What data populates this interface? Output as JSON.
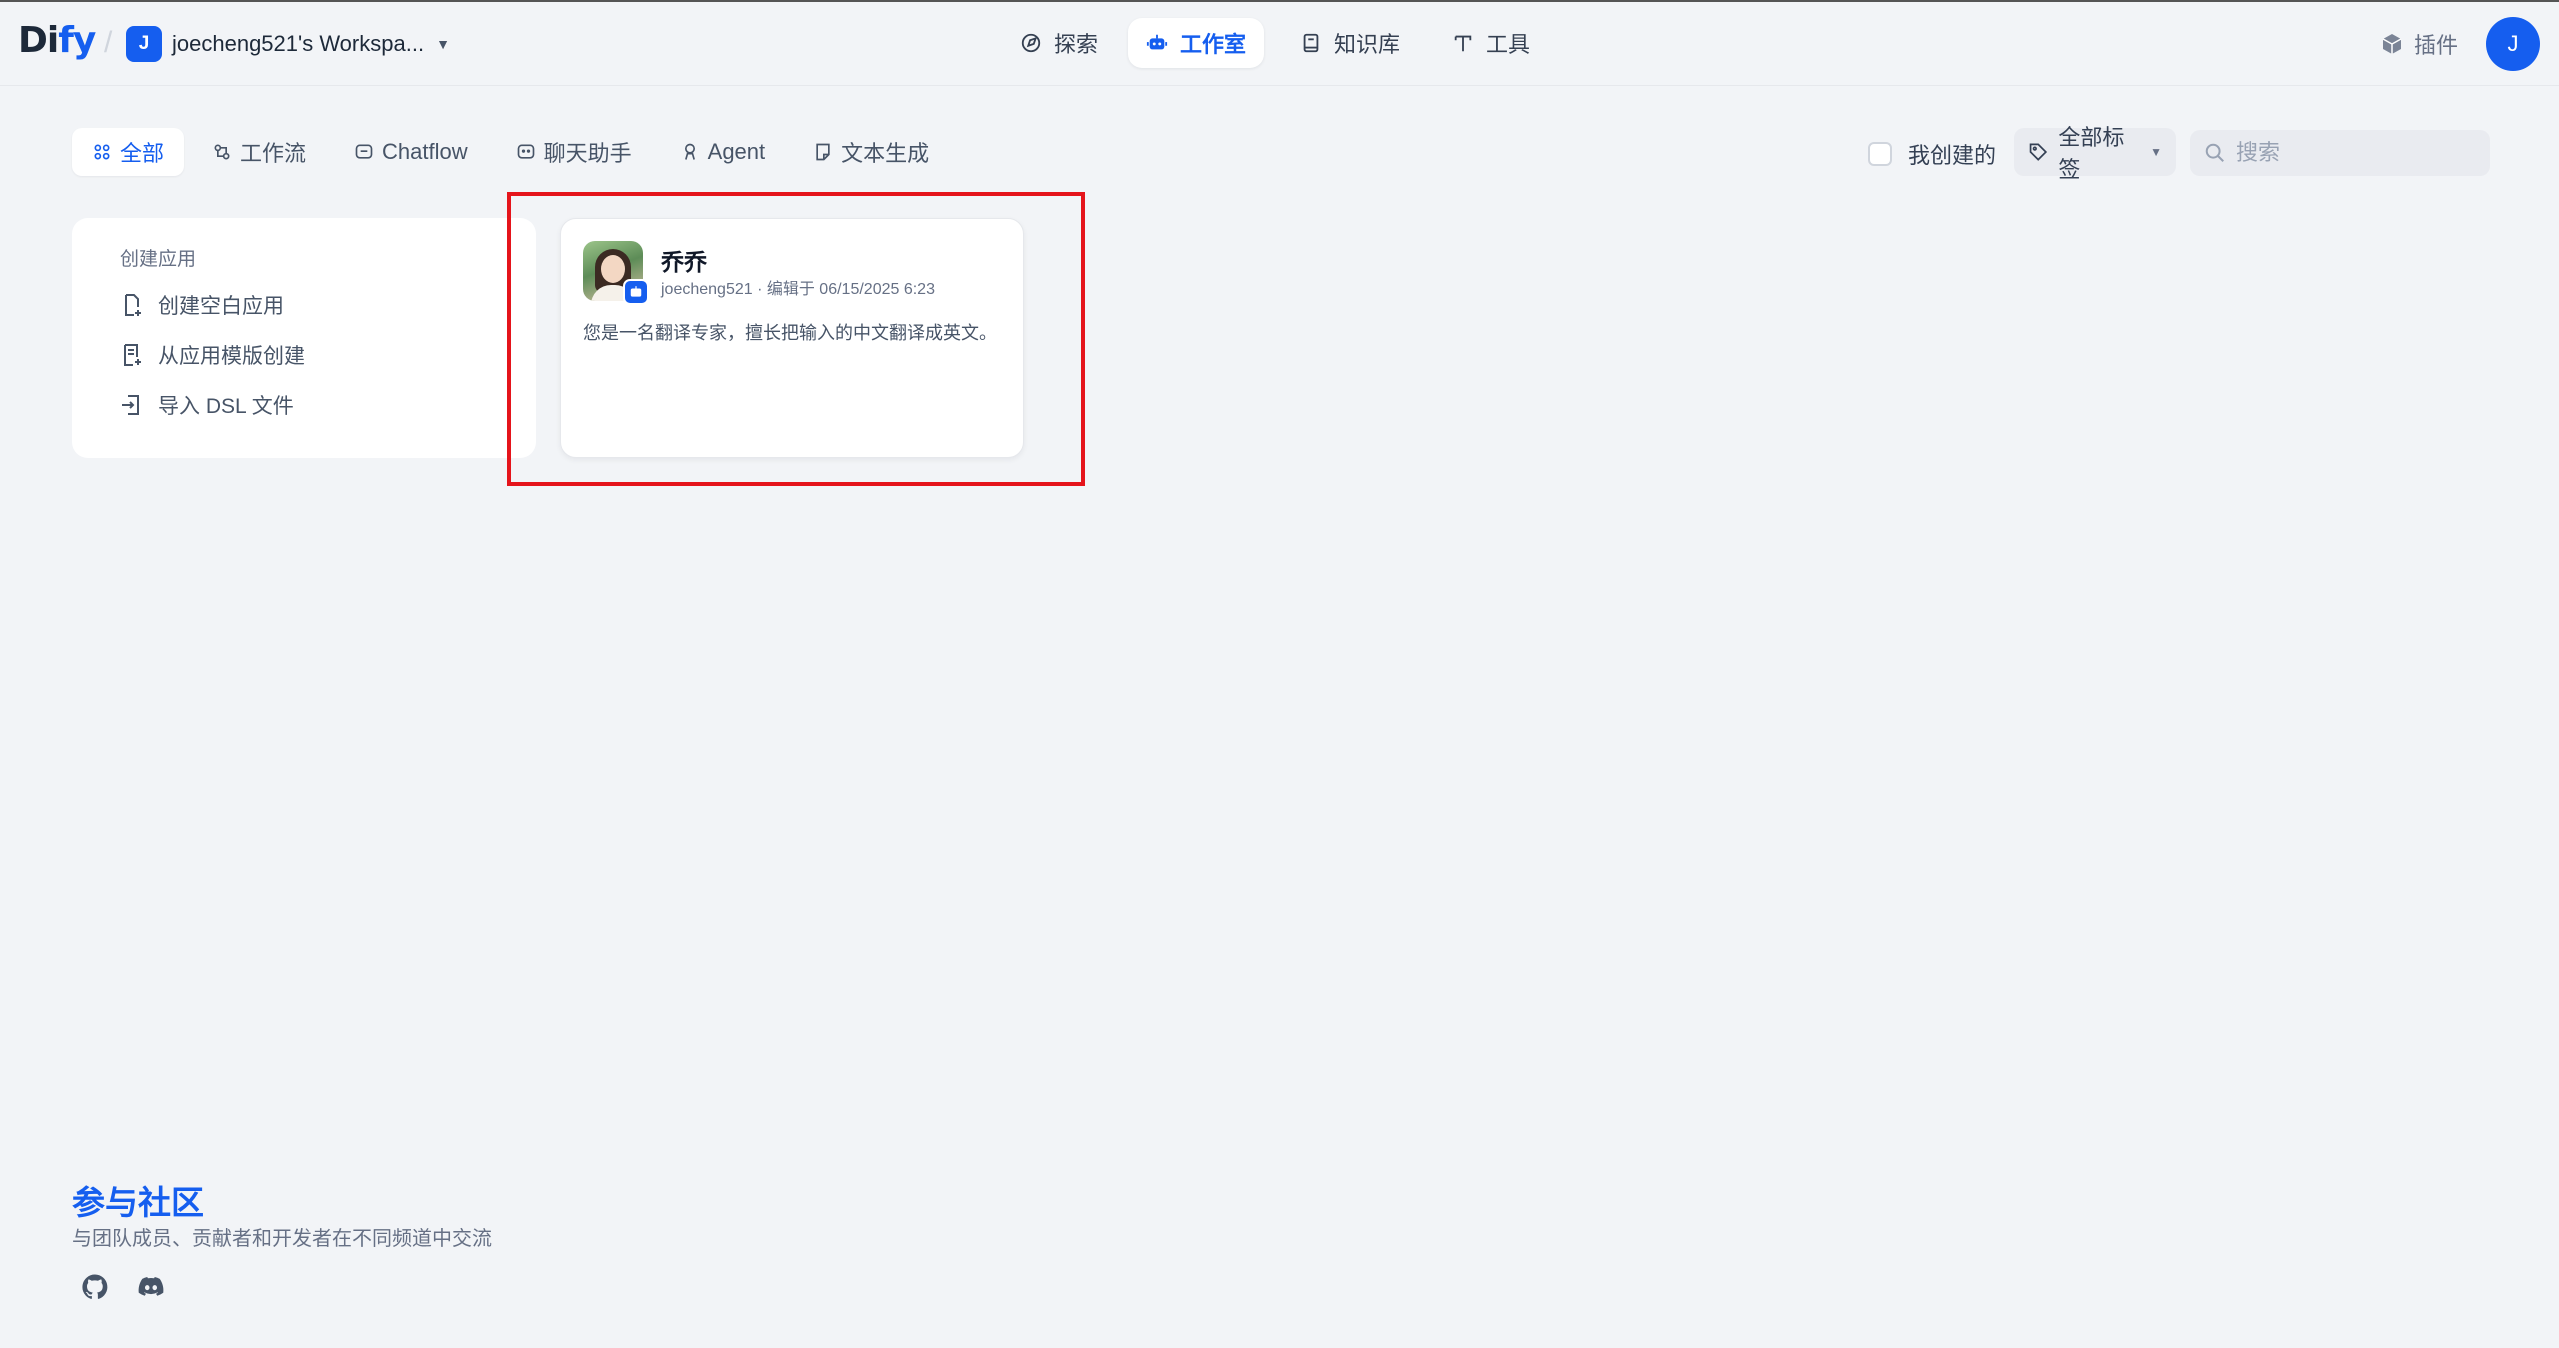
{
  "header": {
    "logo_left": "Di",
    "logo_right": "fy",
    "workspace_initial": "J",
    "workspace_name": "joecheng521's Workspa...",
    "nav": [
      {
        "label": "探索",
        "icon": "compass-icon"
      },
      {
        "label": "工作室",
        "icon": "robot-icon"
      },
      {
        "label": "知识库",
        "icon": "book-icon"
      },
      {
        "label": "工具",
        "icon": "hammer-icon"
      }
    ],
    "plugins_label": "插件",
    "user_initial": "J"
  },
  "filters": {
    "tabs": [
      {
        "label": "全部",
        "icon": "grid-icon",
        "active": true
      },
      {
        "label": "工作流",
        "icon": "workflow-icon"
      },
      {
        "label": "Chatflow",
        "icon": "chatflow-icon"
      },
      {
        "label": "聊天助手",
        "icon": "chat-icon"
      },
      {
        "label": "Agent",
        "icon": "agent-icon"
      },
      {
        "label": "文本生成",
        "icon": "text-icon"
      }
    ],
    "mine_label": "我创建的",
    "tags_label": "全部标签",
    "search_placeholder": "搜索"
  },
  "create_panel": {
    "title": "创建应用",
    "items": [
      {
        "label": "创建空白应用",
        "icon": "new-file-icon"
      },
      {
        "label": "从应用模版创建",
        "icon": "template-icon"
      },
      {
        "label": "导入 DSL 文件",
        "icon": "import-icon"
      }
    ]
  },
  "apps": [
    {
      "name": "乔乔",
      "meta": "joecheng521 · 编辑于 06/15/2025 6:23",
      "description": "您是一名翻译专家，擅长把输入的中文翻译成英文。"
    }
  ],
  "footer": {
    "title": "参与社区",
    "description": "与团队成员、贡献者和开发者在不同频道中交流"
  },
  "colors": {
    "accent": "#155eef",
    "background": "#f2f4f7",
    "highlight_border": "#e5141b"
  }
}
